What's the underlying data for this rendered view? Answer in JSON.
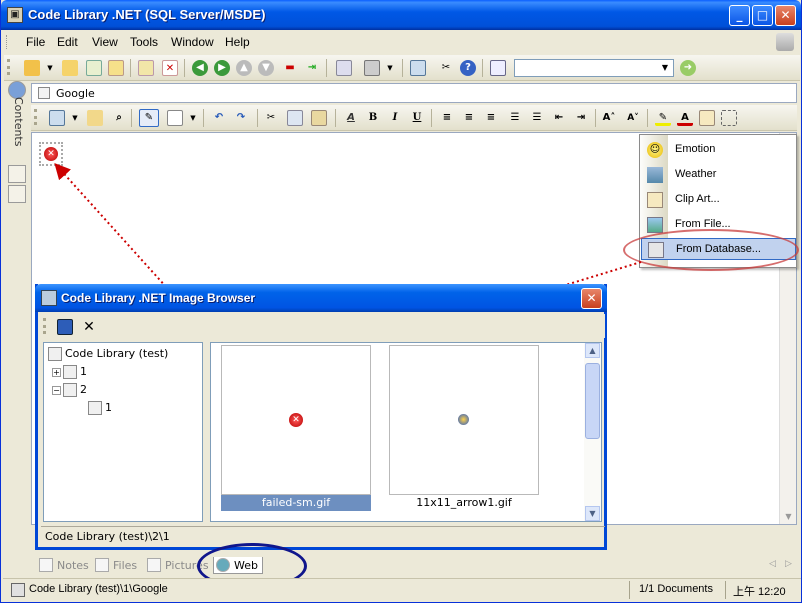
{
  "window": {
    "title": "Code Library .NET (SQL Server/MSDE)"
  },
  "menubar": {
    "items": [
      "File",
      "Edit",
      "View",
      "Tools",
      "Window",
      "Help"
    ]
  },
  "toolbar_main": {
    "combo_value": ""
  },
  "dock": {
    "contents_label": "Contents"
  },
  "address": {
    "value": "Google"
  },
  "popup_menu": {
    "items": [
      {
        "label": "Emotion",
        "icon": "smiley-icon"
      },
      {
        "label": "Weather",
        "icon": "weather-icon"
      },
      {
        "label": "Clip Art...",
        "icon": "clipart-icon"
      },
      {
        "label": "From File...",
        "icon": "picture-file-icon"
      },
      {
        "label": "From Database...",
        "icon": "database-icon"
      }
    ],
    "highlighted_index": 4
  },
  "dialog": {
    "title": "Code Library .NET Image Browser",
    "tree": [
      {
        "label": "Code Library (test)",
        "level": 0
      },
      {
        "label": "1",
        "level": 1
      },
      {
        "label": "2",
        "level": 1
      },
      {
        "label": "1",
        "level": 2
      }
    ],
    "thumbnails": [
      {
        "caption": "failed-sm.gif",
        "selected": true
      },
      {
        "caption": "11x11_arrow1.gif",
        "selected": false
      }
    ],
    "status": "Code Library (test)\\2\\1"
  },
  "tabs": {
    "items": [
      "Notes",
      "Files",
      "Pictures",
      "Web"
    ],
    "active_index": 3
  },
  "statusbar": {
    "path": "Code Library (test)\\1\\Google",
    "documents": "1/1 Documents",
    "time": "上午 12:20"
  },
  "colors": {
    "titlebar": "#0054e3",
    "face": "#ece9d8",
    "highlight": "#316ac5",
    "annotation_red": "#cc0000",
    "annotation_blue": "#10168c"
  }
}
